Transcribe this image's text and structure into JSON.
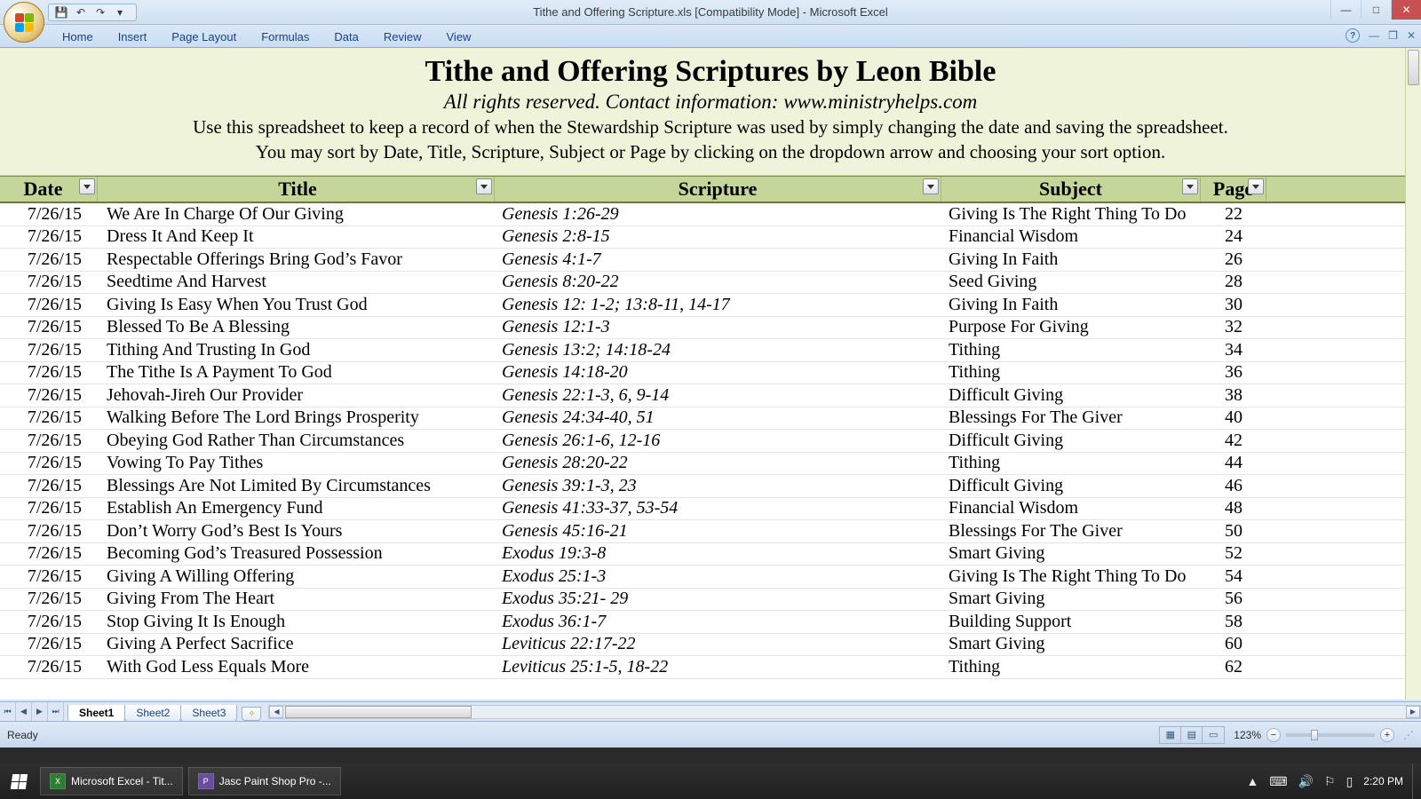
{
  "window": {
    "title": "Tithe and Offering Scripture.xls  [Compatibility Mode] - Microsoft Excel"
  },
  "ribbon": {
    "tabs": [
      "Home",
      "Insert",
      "Page Layout",
      "Formulas",
      "Data",
      "Review",
      "View"
    ]
  },
  "banner": {
    "h1": "Tithe and Offering Scriptures by Leon Bible",
    "sub": "All rights reserved. Contact information: www.ministryhelps.com",
    "inst1": "Use this spreadsheet to keep a record of when the Stewardship Scripture was used by simply changing the date and saving the spreadsheet.",
    "inst2": "You may sort by Date, Title, Scripture, Subject or Page by clicking on the dropdown arrow and choosing your sort option."
  },
  "columns": {
    "date": "Date",
    "title": "Title",
    "scripture": "Scripture",
    "subject": "Subject",
    "page": "Page"
  },
  "rows": [
    {
      "date": "7/26/15",
      "title": "We Are In Charge Of Our Giving",
      "scripture": "Genesis 1:26-29",
      "subject": "Giving Is The Right Thing To Do",
      "page": "22"
    },
    {
      "date": "7/26/15",
      "title": "Dress It And Keep It",
      "scripture": "Genesis 2:8-15",
      "subject": "Financial Wisdom",
      "page": "24"
    },
    {
      "date": "7/26/15",
      "title": "Respectable Offerings Bring God’s Favor",
      "scripture": "Genesis 4:1-7",
      "subject": "Giving In Faith",
      "page": "26"
    },
    {
      "date": "7/26/15",
      "title": "Seedtime And Harvest",
      "scripture": "Genesis 8:20-22",
      "subject": "Seed Giving",
      "page": "28"
    },
    {
      "date": "7/26/15",
      "title": "Giving Is Easy When You Trust God",
      "scripture": "Genesis 12: 1-2; 13:8-11, 14-17",
      "subject": "Giving In Faith",
      "page": "30"
    },
    {
      "date": "7/26/15",
      "title": "Blessed To Be A Blessing",
      "scripture": "Genesis 12:1-3",
      "subject": "Purpose For Giving",
      "page": "32"
    },
    {
      "date": "7/26/15",
      "title": "Tithing And Trusting In God",
      "scripture": "Genesis 13:2; 14:18-24",
      "subject": "Tithing",
      "page": "34"
    },
    {
      "date": "7/26/15",
      "title": "The Tithe Is A Payment To God",
      "scripture": "Genesis 14:18-20",
      "subject": "Tithing",
      "page": "36"
    },
    {
      "date": "7/26/15",
      "title": "Jehovah-Jireh Our Provider",
      "scripture": "Genesis 22:1-3, 6, 9-14",
      "subject": "Difficult Giving",
      "page": "38"
    },
    {
      "date": "7/26/15",
      "title": "Walking Before The Lord Brings Prosperity",
      "scripture": "Genesis 24:34-40, 51",
      "subject": "Blessings For The Giver",
      "page": "40"
    },
    {
      "date": "7/26/15",
      "title": "Obeying God Rather Than Circumstances",
      "scripture": "Genesis 26:1-6, 12-16",
      "subject": "Difficult Giving",
      "page": "42"
    },
    {
      "date": "7/26/15",
      "title": "Vowing To Pay Tithes",
      "scripture": "Genesis 28:20-22",
      "subject": "Tithing",
      "page": "44"
    },
    {
      "date": "7/26/15",
      "title": "Blessings Are Not Limited By Circumstances",
      "scripture": "Genesis 39:1-3, 23",
      "subject": "Difficult Giving",
      "page": "46"
    },
    {
      "date": "7/26/15",
      "title": "Establish An Emergency Fund",
      "scripture": "Genesis 41:33-37, 53-54",
      "subject": "Financial Wisdom",
      "page": "48"
    },
    {
      "date": "7/26/15",
      "title": "Don’t Worry God’s Best Is Yours",
      "scripture": "Genesis 45:16-21",
      "subject": "Blessings For The Giver",
      "page": "50"
    },
    {
      "date": "7/26/15",
      "title": "Becoming God’s Treasured Possession",
      "scripture": "Exodus 19:3-8",
      "subject": "Smart Giving",
      "page": "52"
    },
    {
      "date": "7/26/15",
      "title": "Giving A Willing Offering",
      "scripture": "Exodus 25:1-3",
      "subject": "Giving Is The Right Thing To Do",
      "page": "54"
    },
    {
      "date": "7/26/15",
      "title": "Giving From The Heart",
      "scripture": "Exodus 35:21- 29",
      "subject": "Smart Giving",
      "page": "56"
    },
    {
      "date": "7/26/15",
      "title": "Stop Giving It Is Enough",
      "scripture": "Exodus 36:1-7",
      "subject": "Building Support",
      "page": "58"
    },
    {
      "date": "7/26/15",
      "title": "Giving A Perfect Sacrifice",
      "scripture": "Leviticus 22:17-22",
      "subject": "Smart Giving",
      "page": "60"
    },
    {
      "date": "7/26/15",
      "title": "With God Less Equals More",
      "scripture": "Leviticus 25:1-5, 18-22",
      "subject": "Tithing",
      "page": "62"
    }
  ],
  "sheets": {
    "tabs": [
      "Sheet1",
      "Sheet2",
      "Sheet3"
    ],
    "active": 0
  },
  "statusbar": {
    "ready": "Ready",
    "zoom": "123%"
  },
  "taskbar": {
    "items": [
      {
        "label": "Microsoft Excel - Tit..."
      },
      {
        "label": "Jasc Paint Shop Pro -..."
      }
    ],
    "clock": "2:20 PM"
  }
}
